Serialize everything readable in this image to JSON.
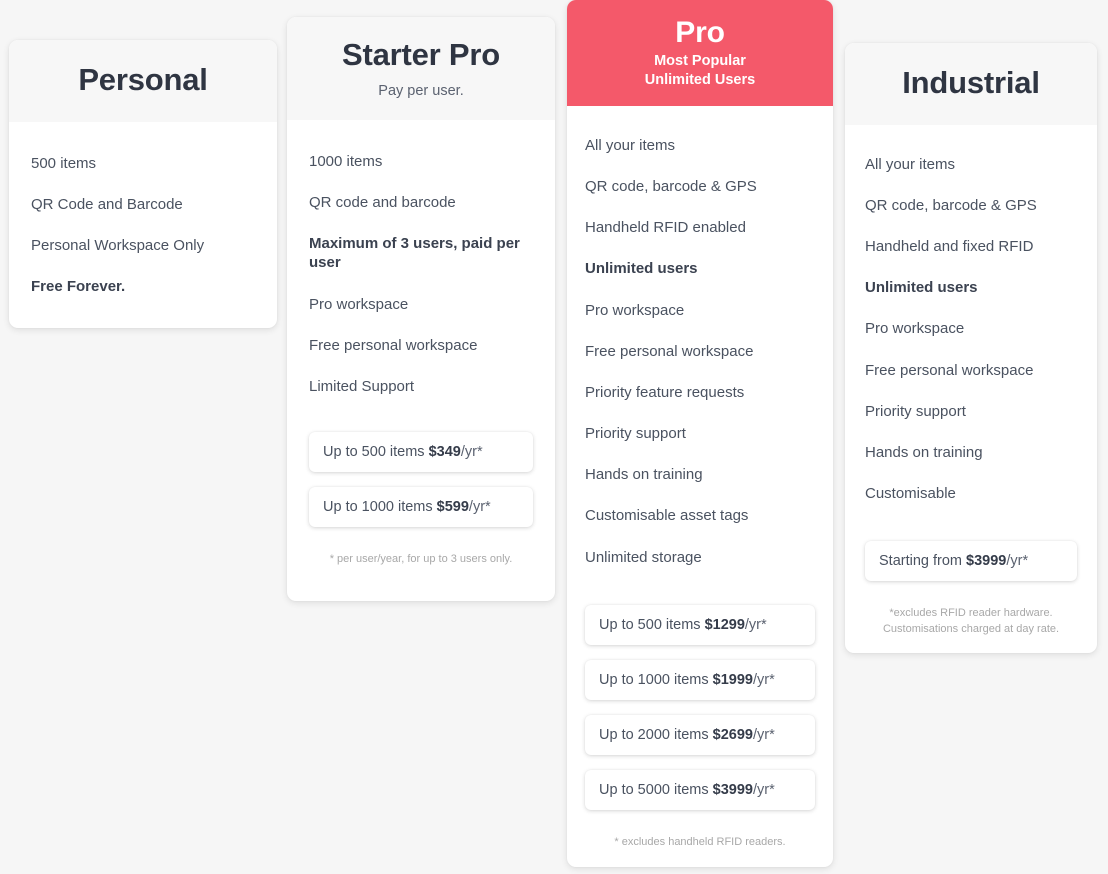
{
  "page": {
    "background_color": "#f6f6f6",
    "accent_color": "#f4596a",
    "text_color": "#4a5260"
  },
  "plans": [
    {
      "id": "personal",
      "title": "Personal",
      "subtitle": "",
      "features": [
        {
          "text": "500 items",
          "bold": false
        },
        {
          "text": "QR Code and Barcode",
          "bold": false
        },
        {
          "text": "Personal Workspace Only",
          "bold": false
        },
        {
          "text": "Free Forever.",
          "bold": true
        }
      ],
      "price_boxes": [],
      "footnote": ""
    },
    {
      "id": "starter-pro",
      "title": "Starter Pro",
      "subtitle": "Pay per user.",
      "features": [
        {
          "text": "1000 items",
          "bold": false
        },
        {
          "text": "QR code and barcode",
          "bold": false
        },
        {
          "text": "Maximum of 3 users, paid per user",
          "bold": true
        },
        {
          "text": "Pro workspace",
          "bold": false
        },
        {
          "text": "Free personal workspace",
          "bold": false
        },
        {
          "text": "Limited Support",
          "bold": false
        }
      ],
      "price_boxes": [
        {
          "label": "Up to 500 items ",
          "amount": "$349",
          "period": "/yr*"
        },
        {
          "label": "Up to 1000 items ",
          "amount": "$599",
          "period": "/yr*"
        }
      ],
      "footnote": "* per user/year, for up to 3 users only."
    },
    {
      "id": "pro",
      "title": "Pro",
      "subtitle": "Most Popular\nUnlimited Users",
      "subtitle_line1": "Most Popular",
      "subtitle_line2": "Unlimited Users",
      "highlighted": true,
      "features": [
        {
          "text": "All your items",
          "bold": false
        },
        {
          "text": "QR code, barcode & GPS",
          "bold": false
        },
        {
          "text": "Handheld RFID enabled",
          "bold": false
        },
        {
          "text": "Unlimited users",
          "bold": true
        },
        {
          "text": "Pro workspace",
          "bold": false
        },
        {
          "text": "Free personal workspace",
          "bold": false
        },
        {
          "text": "Priority feature requests",
          "bold": false
        },
        {
          "text": "Priority support",
          "bold": false
        },
        {
          "text": "Hands on training",
          "bold": false
        },
        {
          "text": "Customisable asset tags",
          "bold": false
        },
        {
          "text": "Unlimited storage",
          "bold": false
        }
      ],
      "price_boxes": [
        {
          "label": "Up to 500 items ",
          "amount": "$1299",
          "period": "/yr*"
        },
        {
          "label": "Up to 1000 items ",
          "amount": "$1999",
          "period": "/yr*"
        },
        {
          "label": "Up to 2000 items ",
          "amount": "$2699",
          "period": "/yr*"
        },
        {
          "label": "Up to 5000 items ",
          "amount": "$3999",
          "period": "/yr*"
        }
      ],
      "footnote": "* excludes handheld RFID readers."
    },
    {
      "id": "industrial",
      "title": "Industrial",
      "subtitle": "",
      "features": [
        {
          "text": "All your items",
          "bold": false
        },
        {
          "text": "QR code, barcode & GPS",
          "bold": false
        },
        {
          "text": "Handheld and fixed RFID",
          "bold": false
        },
        {
          "text": "Unlimited users",
          "bold": true
        },
        {
          "text": "Pro workspace",
          "bold": false
        },
        {
          "text": "Free personal workspace",
          "bold": false
        },
        {
          "text": "Priority support",
          "bold": false
        },
        {
          "text": "Hands on training",
          "bold": false
        },
        {
          "text": "Customisable",
          "bold": false
        }
      ],
      "price_boxes": [
        {
          "label": "Starting from ",
          "amount": "$3999",
          "period": "/yr*"
        }
      ],
      "footnote_line1": "*excludes RFID reader hardware.",
      "footnote_line2": "Customisations charged at day rate."
    }
  ]
}
